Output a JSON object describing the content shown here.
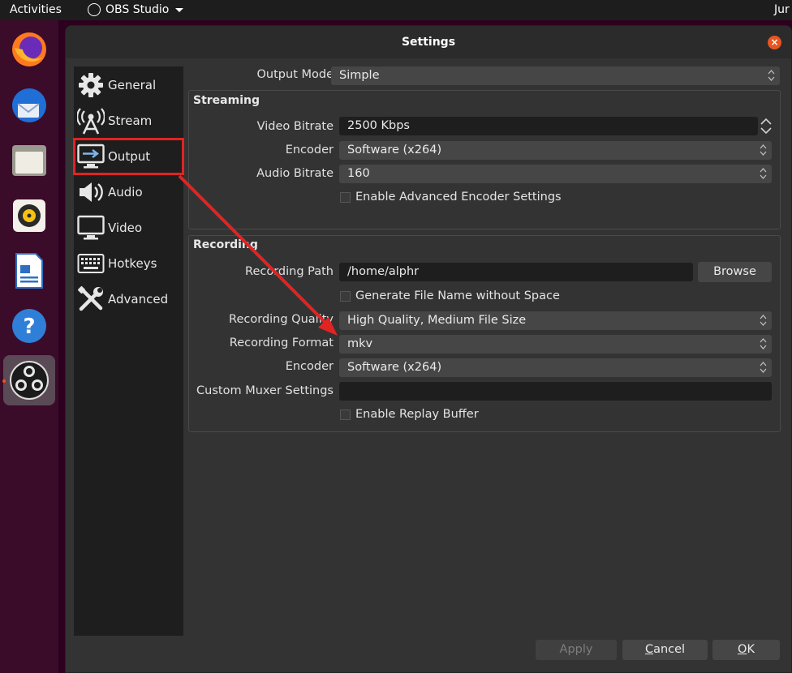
{
  "topbar": {
    "activities": "Activities",
    "app_name": "OBS Studio",
    "clock": "Jur"
  },
  "dock": {
    "items": [
      "firefox-icon",
      "thunderbird-icon",
      "files-icon",
      "rhythmbox-icon",
      "libreoffice-writer-icon",
      "help-icon",
      "obs-studio-icon"
    ]
  },
  "window": {
    "title": "Settings",
    "close_glyph": "×",
    "sidebar": [
      {
        "label": "General",
        "icon": "gear-icon"
      },
      {
        "label": "Stream",
        "icon": "antenna-icon"
      },
      {
        "label": "Output",
        "icon": "monitor-arrow-icon",
        "selected": true
      },
      {
        "label": "Audio",
        "icon": "speaker-icon"
      },
      {
        "label": "Video",
        "icon": "monitor-icon"
      },
      {
        "label": "Hotkeys",
        "icon": "keyboard-icon"
      },
      {
        "label": "Advanced",
        "icon": "tools-icon"
      }
    ],
    "output_mode": {
      "label": "Output Mode",
      "value": "Simple"
    },
    "streaming": {
      "title": "Streaming",
      "video_bitrate": {
        "label": "Video Bitrate",
        "value": "2500 Kbps"
      },
      "encoder": {
        "label": "Encoder",
        "value": "Software (x264)"
      },
      "audio_bitrate": {
        "label": "Audio Bitrate",
        "value": "160"
      },
      "advanced_checkbox": "Enable Advanced Encoder Settings"
    },
    "recording": {
      "title": "Recording",
      "path": {
        "label": "Recording Path",
        "value": "/home/alphr",
        "browse": "Browse"
      },
      "no_space_checkbox": "Generate File Name without Space",
      "quality": {
        "label": "Recording Quality",
        "value": "High Quality, Medium File Size"
      },
      "format": {
        "label": "Recording Format",
        "value": "mkv"
      },
      "encoder": {
        "label": "Encoder",
        "value": "Software (x264)"
      },
      "muxer": {
        "label": "Custom Muxer Settings",
        "value": ""
      },
      "replay_checkbox": "Enable Replay Buffer"
    },
    "buttons": {
      "apply": "Apply",
      "cancel": "Cancel",
      "ok": "OK"
    }
  },
  "colors": {
    "accent": "#e95420",
    "highlight": "#e02424",
    "window_bg": "#333333",
    "sidebar_bg": "#1e1e1e"
  }
}
